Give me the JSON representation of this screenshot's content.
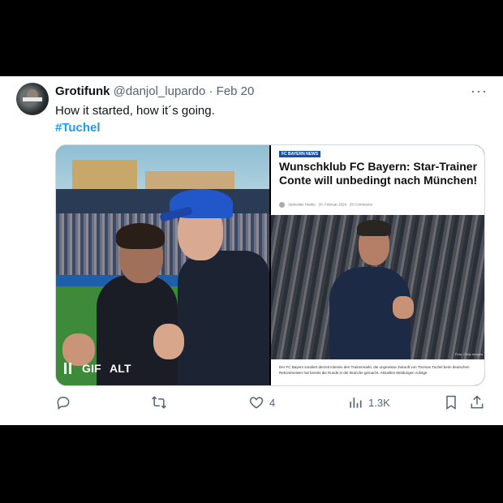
{
  "tweet": {
    "display_name": "Grotifunk",
    "handle": "@danjol_lupardo",
    "separator": "·",
    "date": "Feb 20",
    "text": "How it started, how it´s going.",
    "hashtag": "#Tuchel"
  },
  "media": {
    "gif": {
      "badge": "GIF",
      "alt": "ALT"
    },
    "article": {
      "kicker": "FC BAYERN NEWS",
      "title": "Wunschklub FC Bayern: Star-Trainer Conte will unbedingt nach München!",
      "author": "Vjekoslav Hanko",
      "date": "20. Februar 2024",
      "comments": "28 Comments",
      "photo_credit": "Foto: Getty Images",
      "body": "Der FC Bayern sondiert derzeit intensiv den Trainermarkt, die ungewisse Zukunft von Thomas Tuchel beim deutschen Rekordmeister hat bereits die Runde in der Branche gemacht. Aktuellen Meldungen zufolge"
    }
  },
  "actions": {
    "likes": "4",
    "views": "1.3K"
  },
  "icons": [
    "avatar",
    "more-icon",
    "pause-icon",
    "reply-icon",
    "retweet-icon",
    "like-icon",
    "views-icon",
    "bookmark-icon",
    "share-icon"
  ],
  "colors": {
    "accent": "#1d9bf0",
    "muted": "#536471",
    "text": "#0f1419"
  }
}
